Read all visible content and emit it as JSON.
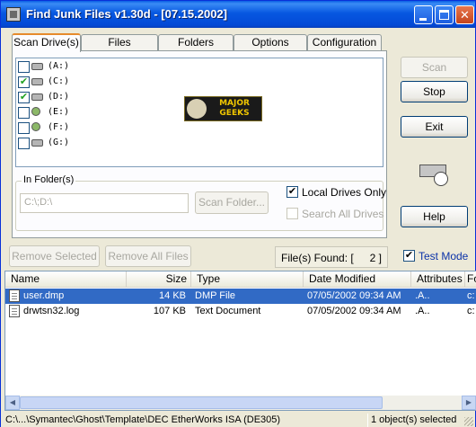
{
  "window": {
    "title": "Find Junk Files v1.30d - [07.15.2002]"
  },
  "tabs": [
    {
      "label": "Scan Drive(s)",
      "active": true
    },
    {
      "label": "Files",
      "active": false
    },
    {
      "label": "Folders",
      "active": false
    },
    {
      "label": "Options",
      "active": false
    },
    {
      "label": "Configuration",
      "active": false
    }
  ],
  "drives": [
    {
      "label": "(A:)",
      "checked": false,
      "icon": "floppy-drive-icon"
    },
    {
      "label": "(C:)",
      "checked": true,
      "icon": "hard-drive-icon"
    },
    {
      "label": "(D:)",
      "checked": true,
      "icon": "hard-drive-icon"
    },
    {
      "label": "(E:)",
      "checked": false,
      "icon": "cd-drive-icon"
    },
    {
      "label": "(F:)",
      "checked": false,
      "icon": "cd-drive-icon"
    },
    {
      "label": "(G:)",
      "checked": false,
      "icon": "removable-drive-icon"
    }
  ],
  "logo": {
    "text_line1": "MAJOR",
    "text_line2": "GEEKS"
  },
  "in_folders": {
    "label": "In Folder(s)",
    "path_value": "C:\\;D:\\",
    "scan_folder_label": "Scan Folder..."
  },
  "options": {
    "local_drives_only": {
      "label": "Local Drives Only",
      "checked": true
    },
    "search_all_drives": {
      "label": "Search All Drives",
      "checked": false,
      "disabled": true
    }
  },
  "side_buttons": {
    "scan": "Scan",
    "stop": "Stop",
    "exit": "Exit",
    "help": "Help"
  },
  "actions": {
    "remove_selected": "Remove Selected",
    "remove_all": "Remove All Files",
    "files_found_label": "File(s) Found:  [",
    "files_found_count": "2 ]",
    "test_mode": {
      "label": "Test Mode",
      "checked": true
    }
  },
  "file_list": {
    "columns": [
      "Name",
      "Size",
      "Type",
      "Date Modified",
      "Attributes",
      "Fo"
    ],
    "rows": [
      {
        "name": "user.dmp",
        "size": "14 KB",
        "type": "DMP File",
        "modified": "07/05/2002 09:34 AM",
        "attributes": ".A..",
        "folder": "c:",
        "selected": true
      },
      {
        "name": "drwtsn32.log",
        "size": "107 KB",
        "type": "Text Document",
        "modified": "07/05/2002 09:34 AM",
        "attributes": ".A..",
        "folder": "c:",
        "selected": false
      }
    ]
  },
  "status": {
    "path": "C:\\...\\Symantec\\Ghost\\Template\\DEC EtherWorks ISA (DE305)",
    "selection": "1 object(s) selected"
  },
  "colors": {
    "titlebar": "#0757e1",
    "selection": "#316ac5",
    "tab_highlight": "#e68b2c"
  }
}
